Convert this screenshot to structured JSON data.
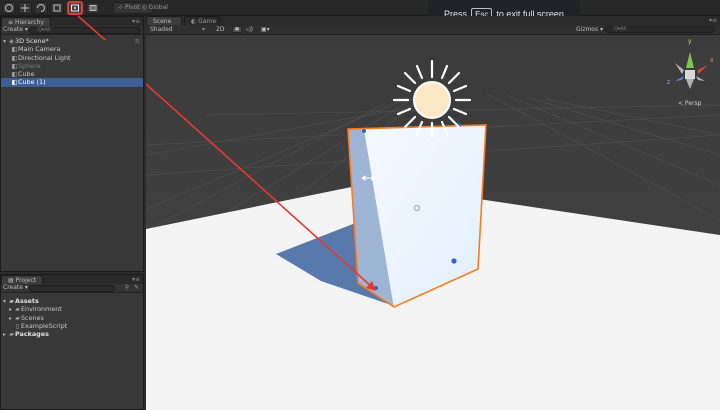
{
  "toolbar": {
    "tools": [
      "hand-tool",
      "move-tool",
      "rotate-tool",
      "scale-tool",
      "rect-tool",
      "transform-tool"
    ],
    "pivot_label": "Pivot",
    "global_label": "Global"
  },
  "notice": {
    "press": "Press",
    "key": "Esc",
    "rest": "to exit full screen"
  },
  "hierarchy": {
    "tab": "Hierarchy",
    "create": "Create ▾",
    "search_placeholder": "Q▾All",
    "scene": "3D Scene*",
    "items": [
      "Main Camera",
      "Directional Light",
      "Sphere",
      "Cube",
      "Cube (1)"
    ]
  },
  "project": {
    "tab": "Project",
    "create": "Create ▾",
    "tree": [
      "Assets",
      "Environment",
      "Scenes",
      "ExampleScript",
      "Packages"
    ]
  },
  "scene": {
    "tabs": [
      "Scene",
      "Game"
    ],
    "shading": "Shaded",
    "mode_2d": "2D",
    "gizmos": "Gizmos ▾",
    "search_placeholder": "Q▾All",
    "persp": "< Persp",
    "axis_y": "y",
    "axis_x": "x",
    "axis_z": "z"
  },
  "colors": {
    "selection_orange": "#ff7a1a",
    "annotation_red": "#e53935",
    "handle_blue": "#2e64c8"
  }
}
